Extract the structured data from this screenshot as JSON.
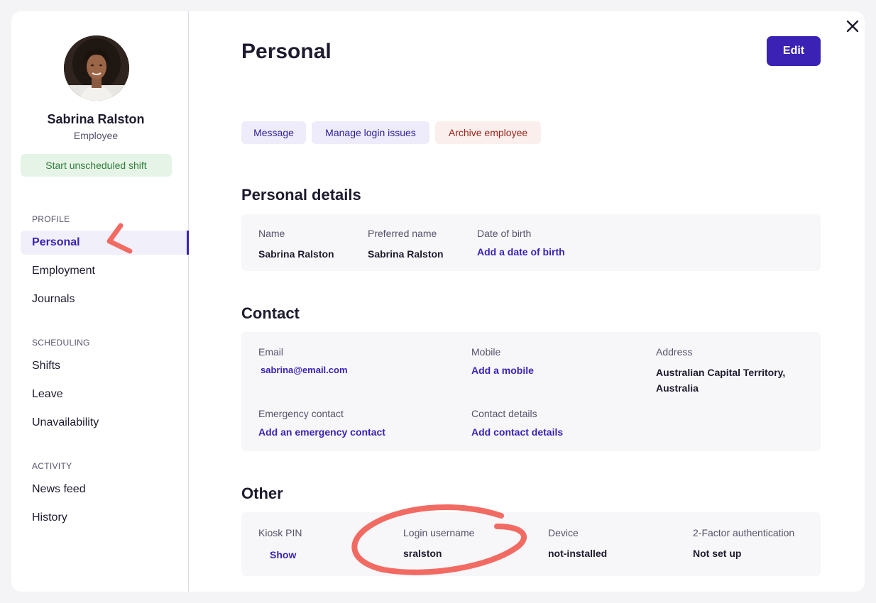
{
  "colors": {
    "accent": "#3b22b5",
    "success_bg": "#e6f4e8",
    "success_text": "#2f7d3a",
    "danger_bg": "#fbefed",
    "danger_text": "#9c2319",
    "annotation": "#f26b63"
  },
  "employee": {
    "name": "Sabrina Ralston",
    "role": "Employee",
    "start_shift_label": "Start unscheduled shift"
  },
  "sidebar": {
    "sections": [
      {
        "label": "PROFILE",
        "items": [
          "Personal",
          "Employment",
          "Journals"
        ]
      },
      {
        "label": "SCHEDULING",
        "items": [
          "Shifts",
          "Leave",
          "Unavailability"
        ]
      },
      {
        "label": "ACTIVITY",
        "items": [
          "News feed",
          "History"
        ]
      }
    ],
    "active_item": "Personal"
  },
  "page": {
    "title": "Personal",
    "edit_label": "Edit"
  },
  "actions": {
    "message": "Message",
    "manage_login": "Manage login issues",
    "archive": "Archive employee"
  },
  "personal_details": {
    "heading": "Personal details",
    "name_label": "Name",
    "name_value": "Sabrina Ralston",
    "preferred_label": "Preferred name",
    "preferred_value": "Sabrina Ralston",
    "dob_label": "Date of birth",
    "dob_link": "Add a date of birth"
  },
  "contact": {
    "heading": "Contact",
    "email_label": "Email",
    "email_value": "sabrina@email.com",
    "mobile_label": "Mobile",
    "mobile_link": "Add a mobile",
    "address_label": "Address",
    "address_line1": "Australian Capital Territory,",
    "address_line2": "Australia",
    "emergency_label": "Emergency contact",
    "emergency_link": "Add an emergency contact",
    "details_label": "Contact details",
    "details_link": "Add contact details"
  },
  "other": {
    "heading": "Other",
    "kiosk_label": "Kiosk PIN",
    "kiosk_link": "Show",
    "username_label": "Login username",
    "username_value": "sralston",
    "device_label": "Device",
    "device_value": "not-installed",
    "twofa_label": "2-Factor authentication",
    "twofa_value": "Not set up"
  },
  "icons": {
    "close": "close-icon",
    "avatar": "avatar"
  }
}
